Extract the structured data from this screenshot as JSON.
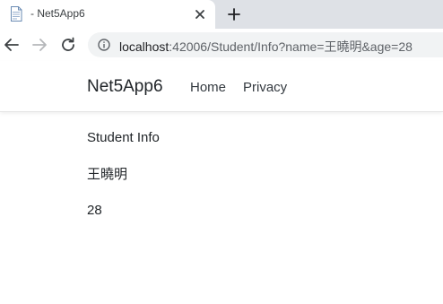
{
  "browser": {
    "tab": {
      "title": "- Net5App6",
      "favicon": "document-icon"
    },
    "new_tab_icon": "plus-icon",
    "address_bar": {
      "host": "localhost",
      "rest": ":42006/Student/Info?name=王曉明&age=28"
    }
  },
  "navbar": {
    "brand": "Net5App6",
    "links": [
      {
        "label": "Home"
      },
      {
        "label": "Privacy"
      }
    ]
  },
  "main": {
    "title": "Student Info",
    "name": "王曉明",
    "age": "28"
  }
}
